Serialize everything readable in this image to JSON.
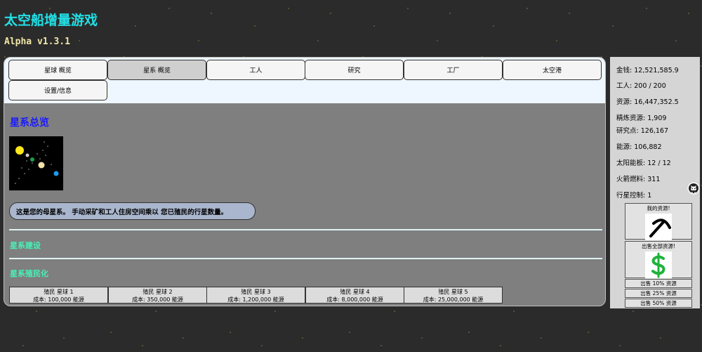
{
  "header": {
    "title": "太空船增量游戏",
    "version": "Alpha v1.3.1"
  },
  "tabs": [
    {
      "label": "星球 概览",
      "active": false
    },
    {
      "label": "星系 概览",
      "active": true
    },
    {
      "label": "工人",
      "active": false
    },
    {
      "label": "研究",
      "active": false
    },
    {
      "label": "工厂",
      "active": false
    },
    {
      "label": "太空港",
      "active": false
    },
    {
      "label": "设置/信息",
      "active": false
    }
  ],
  "main": {
    "section_title": "星系总览",
    "info_text": "这是您的母星系。 手动采矿和工人住房空间乘以 您已殖民的行星数量。",
    "build_title": "星系建设",
    "colonize_title": "星系殖民化",
    "colonies": [
      {
        "name": "殖民 星球 1",
        "cost": "成本: 100,000 能源"
      },
      {
        "name": "殖民 星球 2",
        "cost": "成本: 350,000 能源"
      },
      {
        "name": "殖民 星球 3",
        "cost": "成本: 1,200,000 能源"
      },
      {
        "name": "殖民 星球 4",
        "cost": "成本: 8,000,000 能源"
      },
      {
        "name": "殖民 星球 5",
        "cost": "成本: 25,000,000 能源"
      }
    ]
  },
  "resources": [
    {
      "label": "金钱:",
      "value": "12,521,585.9"
    },
    {
      "label": "工人:",
      "value": "200 / 200"
    },
    {
      "label": "资源:",
      "value": "16,447,352.5"
    },
    {
      "label": "精炼资源:",
      "value": "1,909"
    },
    {
      "label": "研究点:",
      "value": "126,167"
    },
    {
      "label": "能源:",
      "value": "106,882"
    },
    {
      "label": "太阳能板:",
      "value": "12 / 12"
    },
    {
      "label": "火箭燃料:",
      "value": "311"
    },
    {
      "label": "行星控制:",
      "value": "1"
    }
  ],
  "sell": {
    "my_resources": "我的资源!",
    "sell_all": "出售全部资源!",
    "sell_10": "出售 10% 资源",
    "sell_25": "出售 25% 资源",
    "sell_50": "出售 50% 资源",
    "pickaxe_icon": "pickaxe-icon",
    "dollar_icon": "dollar-icon"
  },
  "misc": {
    "close": "x"
  },
  "colors": {
    "title": "#22e0e6",
    "section_title": "#1a1aff",
    "sub_title": "#47f0b8",
    "dollar": "#1db33a"
  }
}
